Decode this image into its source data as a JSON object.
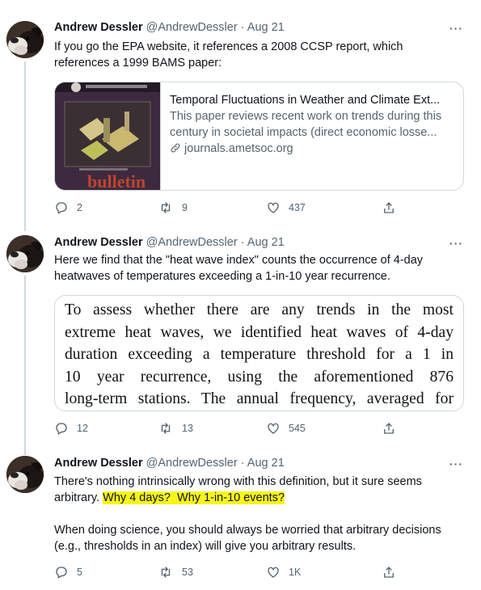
{
  "tweets": [
    {
      "name": "Andrew Dessler",
      "handle": "@AndrewDessler",
      "sep": "·",
      "date": "Aug 21",
      "text": "If you go the EPA website, it references a 2008 CCSP report, which references a 1999 BAMS paper:",
      "card": {
        "title": "Temporal Fluctuations in Weather and Climate Ext...",
        "description": "This paper reviews recent work on trends during this century in societal impacts (direct economic losse...",
        "link": "journals.ametsoc.org",
        "thumb_word": "bulletin"
      },
      "replies": "2",
      "retweets": "9",
      "likes": "437"
    },
    {
      "name": "Andrew Dessler",
      "handle": "@AndrewDessler",
      "sep": "·",
      "date": "Aug 21",
      "text": "Here we find that the \"heat wave index\" counts the occurrence of 4-day heatwaves of temperatures exceeding a 1-in-10 year recurrence.",
      "quote_lines": [
        "To assess whether there are any trends in the most",
        "extreme heat waves, we identified heat waves of 4-day",
        "duration exceeding a temperature threshold for a 1 in",
        "10 year recurrence, using the aforementioned 876",
        "long-term stations. The annual frequency, averaged for"
      ],
      "replies": "12",
      "retweets": "13",
      "likes": "545"
    },
    {
      "name": "Andrew Dessler",
      "handle": "@AndrewDessler",
      "sep": "·",
      "date": "Aug 21",
      "text_line1": "There's nothing intrinsically wrong with this definition, but it sure seems",
      "text_line2_plain": "arbitrary.",
      "text_line2_highlight": "Why 4 days?  Why 1-in-10 events?",
      "text_para2": "When doing science, you should always be worried that arbitrary decisions (e.g., thresholds in an index) will give you arbitrary results.",
      "replies": "5",
      "retweets": "53",
      "likes": "1K"
    }
  ],
  "more_label": "···",
  "colors": {
    "text": "#0f1419",
    "muted": "#536471",
    "border": "#cfd9de",
    "highlight": "#f7f51a"
  },
  "icons": [
    "reply-icon",
    "retweet-icon",
    "like-icon",
    "share-icon",
    "link-icon",
    "more-icon"
  ]
}
